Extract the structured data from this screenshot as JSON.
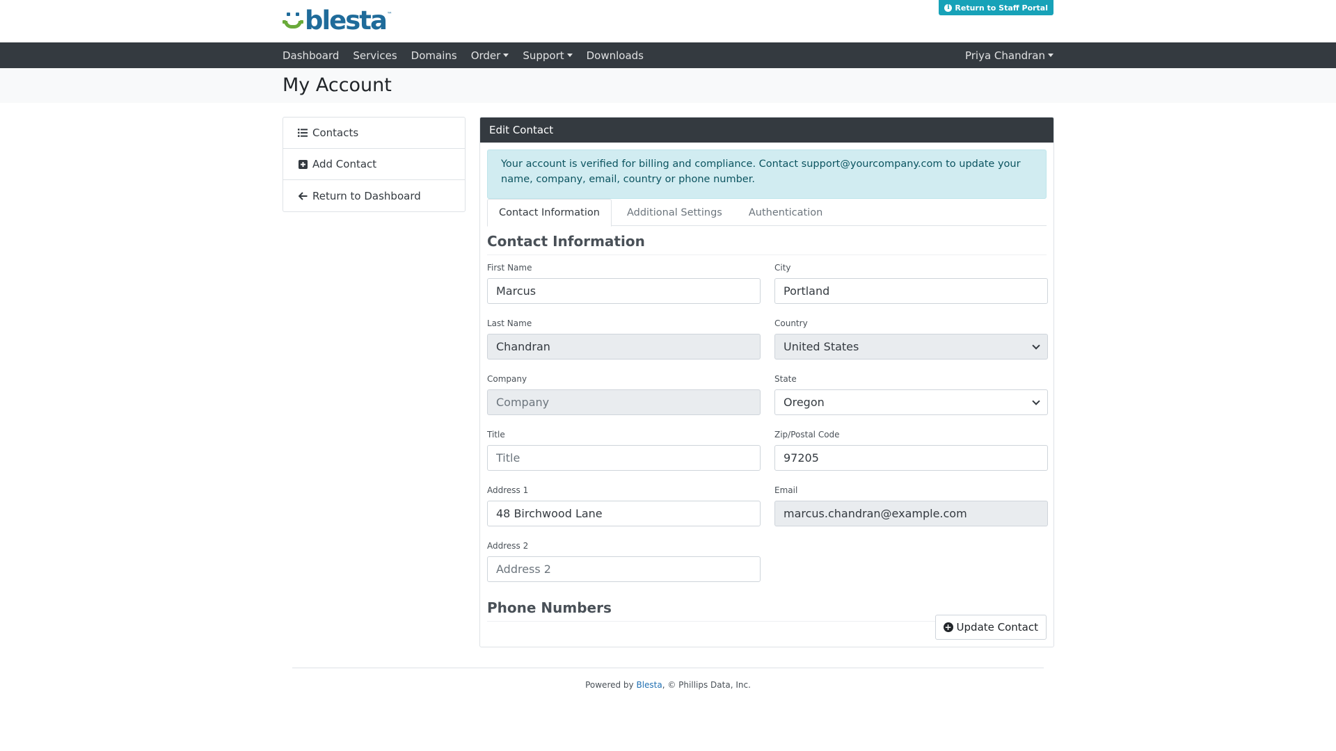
{
  "brand": {
    "name": "blesta",
    "tm": "™",
    "colors": {
      "blue": "#1f6b9a",
      "green": "#6aaa3a"
    }
  },
  "header": {
    "staff_portal_label": "Return to Staff Portal",
    "staff_portal_icon": "info-circle-icon"
  },
  "nav": {
    "items": [
      {
        "label": "Dashboard",
        "dropdown": false
      },
      {
        "label": "Services",
        "dropdown": false
      },
      {
        "label": "Domains",
        "dropdown": false
      },
      {
        "label": "Order",
        "dropdown": true
      },
      {
        "label": "Support",
        "dropdown": true
      },
      {
        "label": "Downloads",
        "dropdown": false
      }
    ],
    "user": "Priya Chandran"
  },
  "page": {
    "title": "My Account"
  },
  "sidebar": {
    "items": [
      {
        "label": "Contacts",
        "icon": "list-icon"
      },
      {
        "label": "Add Contact",
        "icon": "plus-square-icon"
      },
      {
        "label": "Return to Dashboard",
        "icon": "arrow-left-icon"
      }
    ]
  },
  "panel": {
    "title": "Edit Contact",
    "alert": "Your account is verified for billing and compliance. Contact support@yourcompany.com to update your name, company, email, country or phone number.",
    "tabs": [
      "Contact Information",
      "Additional Settings",
      "Authentication"
    ],
    "section_title": "Contact Information",
    "phone_title": "Phone Numbers",
    "update_label": "Update Contact"
  },
  "form": {
    "first_name": {
      "label": "First Name",
      "value": "Marcus",
      "placeholder": "First Name"
    },
    "last_name": {
      "label": "Last Name",
      "value": "Chandran",
      "placeholder": "Last Name"
    },
    "company": {
      "label": "Company",
      "value": "",
      "placeholder": "Company"
    },
    "title": {
      "label": "Title",
      "value": "",
      "placeholder": "Title"
    },
    "address1": {
      "label": "Address 1",
      "value": "48 Birchwood Lane",
      "placeholder": "Address 1"
    },
    "address2": {
      "label": "Address 2",
      "value": "",
      "placeholder": "Address 2"
    },
    "city": {
      "label": "City",
      "value": "Portland",
      "placeholder": "City"
    },
    "country": {
      "label": "Country",
      "value": "United States"
    },
    "state": {
      "label": "State",
      "value": "Oregon"
    },
    "zip": {
      "label": "Zip/Postal Code",
      "value": "97205",
      "placeholder": "Zip/Postal Code"
    },
    "email": {
      "label": "Email",
      "value": "marcus.chandran@example.com",
      "placeholder": "Email"
    }
  },
  "footer": {
    "prefix": "Powered by ",
    "link": "Blesta",
    "suffix": ", © Phillips Data, Inc."
  }
}
